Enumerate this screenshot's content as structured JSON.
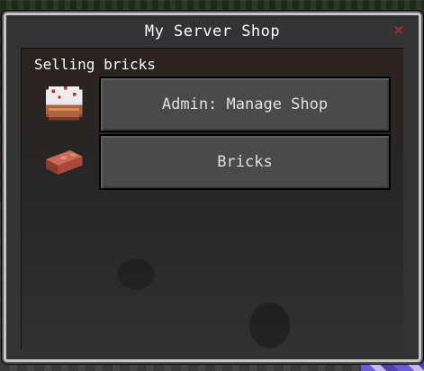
{
  "window": {
    "title": "My Server Shop",
    "close_glyph": "×"
  },
  "shop": {
    "subtitle": "Selling bricks",
    "buttons": [
      {
        "label": "Admin: Manage Shop",
        "icon": "cake-icon"
      },
      {
        "label": "Bricks",
        "icon": "brick-icon"
      }
    ]
  },
  "colors": {
    "dialog_bg": "#333333",
    "button_bg": "#4a4a4a",
    "close": "#b03030",
    "text": "#ffffff"
  }
}
